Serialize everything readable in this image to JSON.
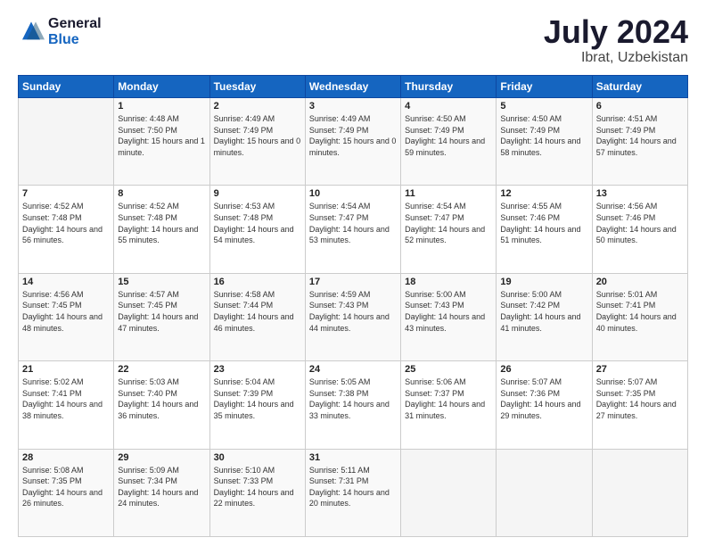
{
  "logo": {
    "general": "General",
    "blue": "Blue"
  },
  "title": {
    "month_year": "July 2024",
    "location": "Ibrat, Uzbekistan"
  },
  "weekdays": [
    "Sunday",
    "Monday",
    "Tuesday",
    "Wednesday",
    "Thursday",
    "Friday",
    "Saturday"
  ],
  "weeks": [
    [
      {
        "day": "",
        "sunrise": "",
        "sunset": "",
        "daylight": ""
      },
      {
        "day": "1",
        "sunrise": "Sunrise: 4:48 AM",
        "sunset": "Sunset: 7:50 PM",
        "daylight": "Daylight: 15 hours and 1 minute."
      },
      {
        "day": "2",
        "sunrise": "Sunrise: 4:49 AM",
        "sunset": "Sunset: 7:49 PM",
        "daylight": "Daylight: 15 hours and 0 minutes."
      },
      {
        "day": "3",
        "sunrise": "Sunrise: 4:49 AM",
        "sunset": "Sunset: 7:49 PM",
        "daylight": "Daylight: 15 hours and 0 minutes."
      },
      {
        "day": "4",
        "sunrise": "Sunrise: 4:50 AM",
        "sunset": "Sunset: 7:49 PM",
        "daylight": "Daylight: 14 hours and 59 minutes."
      },
      {
        "day": "5",
        "sunrise": "Sunrise: 4:50 AM",
        "sunset": "Sunset: 7:49 PM",
        "daylight": "Daylight: 14 hours and 58 minutes."
      },
      {
        "day": "6",
        "sunrise": "Sunrise: 4:51 AM",
        "sunset": "Sunset: 7:49 PM",
        "daylight": "Daylight: 14 hours and 57 minutes."
      }
    ],
    [
      {
        "day": "7",
        "sunrise": "Sunrise: 4:52 AM",
        "sunset": "Sunset: 7:48 PM",
        "daylight": "Daylight: 14 hours and 56 minutes."
      },
      {
        "day": "8",
        "sunrise": "Sunrise: 4:52 AM",
        "sunset": "Sunset: 7:48 PM",
        "daylight": "Daylight: 14 hours and 55 minutes."
      },
      {
        "day": "9",
        "sunrise": "Sunrise: 4:53 AM",
        "sunset": "Sunset: 7:48 PM",
        "daylight": "Daylight: 14 hours and 54 minutes."
      },
      {
        "day": "10",
        "sunrise": "Sunrise: 4:54 AM",
        "sunset": "Sunset: 7:47 PM",
        "daylight": "Daylight: 14 hours and 53 minutes."
      },
      {
        "day": "11",
        "sunrise": "Sunrise: 4:54 AM",
        "sunset": "Sunset: 7:47 PM",
        "daylight": "Daylight: 14 hours and 52 minutes."
      },
      {
        "day": "12",
        "sunrise": "Sunrise: 4:55 AM",
        "sunset": "Sunset: 7:46 PM",
        "daylight": "Daylight: 14 hours and 51 minutes."
      },
      {
        "day": "13",
        "sunrise": "Sunrise: 4:56 AM",
        "sunset": "Sunset: 7:46 PM",
        "daylight": "Daylight: 14 hours and 50 minutes."
      }
    ],
    [
      {
        "day": "14",
        "sunrise": "Sunrise: 4:56 AM",
        "sunset": "Sunset: 7:45 PM",
        "daylight": "Daylight: 14 hours and 48 minutes."
      },
      {
        "day": "15",
        "sunrise": "Sunrise: 4:57 AM",
        "sunset": "Sunset: 7:45 PM",
        "daylight": "Daylight: 14 hours and 47 minutes."
      },
      {
        "day": "16",
        "sunrise": "Sunrise: 4:58 AM",
        "sunset": "Sunset: 7:44 PM",
        "daylight": "Daylight: 14 hours and 46 minutes."
      },
      {
        "day": "17",
        "sunrise": "Sunrise: 4:59 AM",
        "sunset": "Sunset: 7:43 PM",
        "daylight": "Daylight: 14 hours and 44 minutes."
      },
      {
        "day": "18",
        "sunrise": "Sunrise: 5:00 AM",
        "sunset": "Sunset: 7:43 PM",
        "daylight": "Daylight: 14 hours and 43 minutes."
      },
      {
        "day": "19",
        "sunrise": "Sunrise: 5:00 AM",
        "sunset": "Sunset: 7:42 PM",
        "daylight": "Daylight: 14 hours and 41 minutes."
      },
      {
        "day": "20",
        "sunrise": "Sunrise: 5:01 AM",
        "sunset": "Sunset: 7:41 PM",
        "daylight": "Daylight: 14 hours and 40 minutes."
      }
    ],
    [
      {
        "day": "21",
        "sunrise": "Sunrise: 5:02 AM",
        "sunset": "Sunset: 7:41 PM",
        "daylight": "Daylight: 14 hours and 38 minutes."
      },
      {
        "day": "22",
        "sunrise": "Sunrise: 5:03 AM",
        "sunset": "Sunset: 7:40 PM",
        "daylight": "Daylight: 14 hours and 36 minutes."
      },
      {
        "day": "23",
        "sunrise": "Sunrise: 5:04 AM",
        "sunset": "Sunset: 7:39 PM",
        "daylight": "Daylight: 14 hours and 35 minutes."
      },
      {
        "day": "24",
        "sunrise": "Sunrise: 5:05 AM",
        "sunset": "Sunset: 7:38 PM",
        "daylight": "Daylight: 14 hours and 33 minutes."
      },
      {
        "day": "25",
        "sunrise": "Sunrise: 5:06 AM",
        "sunset": "Sunset: 7:37 PM",
        "daylight": "Daylight: 14 hours and 31 minutes."
      },
      {
        "day": "26",
        "sunrise": "Sunrise: 5:07 AM",
        "sunset": "Sunset: 7:36 PM",
        "daylight": "Daylight: 14 hours and 29 minutes."
      },
      {
        "day": "27",
        "sunrise": "Sunrise: 5:07 AM",
        "sunset": "Sunset: 7:35 PM",
        "daylight": "Daylight: 14 hours and 27 minutes."
      }
    ],
    [
      {
        "day": "28",
        "sunrise": "Sunrise: 5:08 AM",
        "sunset": "Sunset: 7:35 PM",
        "daylight": "Daylight: 14 hours and 26 minutes."
      },
      {
        "day": "29",
        "sunrise": "Sunrise: 5:09 AM",
        "sunset": "Sunset: 7:34 PM",
        "daylight": "Daylight: 14 hours and 24 minutes."
      },
      {
        "day": "30",
        "sunrise": "Sunrise: 5:10 AM",
        "sunset": "Sunset: 7:33 PM",
        "daylight": "Daylight: 14 hours and 22 minutes."
      },
      {
        "day": "31",
        "sunrise": "Sunrise: 5:11 AM",
        "sunset": "Sunset: 7:31 PM",
        "daylight": "Daylight: 14 hours and 20 minutes."
      },
      {
        "day": "",
        "sunrise": "",
        "sunset": "",
        "daylight": ""
      },
      {
        "day": "",
        "sunrise": "",
        "sunset": "",
        "daylight": ""
      },
      {
        "day": "",
        "sunrise": "",
        "sunset": "",
        "daylight": ""
      }
    ]
  ]
}
